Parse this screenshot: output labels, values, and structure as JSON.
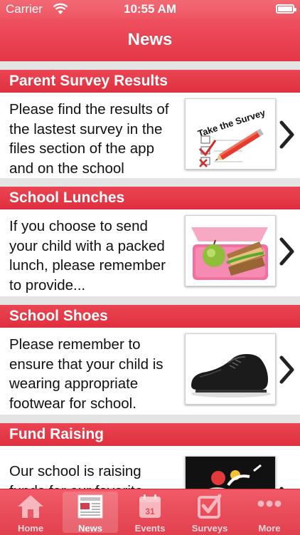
{
  "status_bar": {
    "carrier": "Carrier",
    "time": "10:55 AM"
  },
  "nav": {
    "title": "News"
  },
  "colors": {
    "accent": "#e53645",
    "separator": "#e4e4e4"
  },
  "news": [
    {
      "title": "Parent Survey Results",
      "body": "Please find the results of the lastest survey in the files section of the app and on the school",
      "thumb": "take-the-survey-image",
      "thumb_text": "Take the Survey"
    },
    {
      "title": "School Lunches",
      "body": "If you choose to send your child with a packed lunch, please remember to provide...",
      "thumb": "lunchbox-image"
    },
    {
      "title": "School Shoes",
      "body": "Please remember to ensure that your child is wearing appropriate footwear for school.",
      "thumb": "school-shoe-image"
    },
    {
      "title": "Fund Raising",
      "body": "Our school is raising funds for our favorite",
      "thumb": "fundraising-image"
    }
  ],
  "tabs": [
    {
      "label": "Home",
      "icon": "home-icon"
    },
    {
      "label": "News",
      "icon": "news-icon",
      "active": true
    },
    {
      "label": "Events",
      "icon": "calendar-icon",
      "badge": "31"
    },
    {
      "label": "Surveys",
      "icon": "checkbox-icon"
    },
    {
      "label": "More",
      "icon": "more-icon"
    }
  ]
}
